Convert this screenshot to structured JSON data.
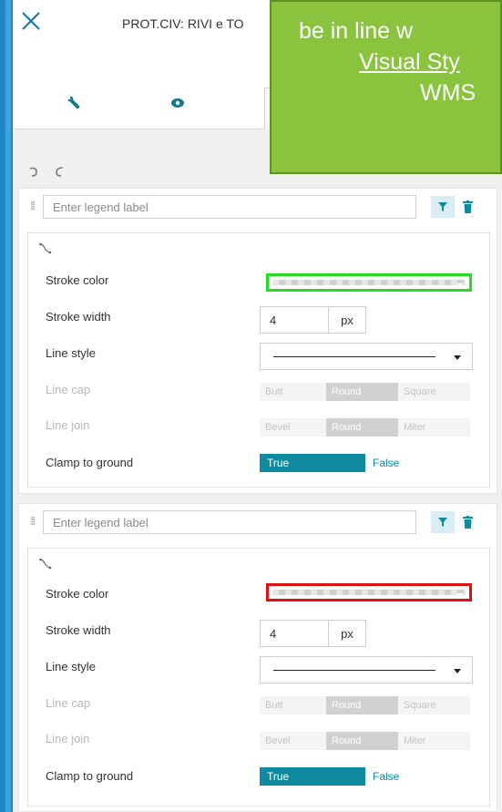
{
  "header": {
    "layer_title": "PROT.CIV: RIVI e TO",
    "tabs": [
      {
        "icon": "wrench-icon"
      },
      {
        "icon": "eye-icon"
      },
      {
        "icon": "style-icon"
      }
    ]
  },
  "callout": {
    "line1": "be in line w",
    "line2": "Visual Sty",
    "line3": "WMS",
    "color": "#8ac43f"
  },
  "toolbar": {
    "undo_icon": "undo-icon",
    "redo_icon": "redo-icon"
  },
  "rules": [
    {
      "legend_placeholder": "Enter legend label",
      "stroke_color_label": "Stroke color",
      "stroke_color": "#22dd22",
      "stroke_width_label": "Stroke width",
      "stroke_width": "4",
      "stroke_width_unit": "px",
      "line_style_label": "Line style",
      "line_cap_label": "Line cap",
      "line_cap_options": [
        "Butt",
        "Round",
        "Square"
      ],
      "line_cap_selected": "Round",
      "line_join_label": "Line join",
      "line_join_options": [
        "Bevel",
        "Round",
        "Miter"
      ],
      "line_join_selected": "Round",
      "clamp_label": "Clamp to ground",
      "clamp_true": "True",
      "clamp_false": "False",
      "clamp_selected": "True"
    },
    {
      "legend_placeholder": "Enter legend label",
      "stroke_color_label": "Stroke color",
      "stroke_color": "#dd1111",
      "stroke_width_label": "Stroke width",
      "stroke_width": "4",
      "stroke_width_unit": "px",
      "line_style_label": "Line style",
      "line_cap_label": "Line cap",
      "line_cap_options": [
        "Butt",
        "Round",
        "Square"
      ],
      "line_cap_selected": "Round",
      "line_join_label": "Line join",
      "line_join_options": [
        "Bevel",
        "Round",
        "Miter"
      ],
      "line_join_selected": "Round",
      "clamp_label": "Clamp to ground",
      "clamp_true": "True",
      "clamp_false": "False",
      "clamp_selected": "True"
    }
  ],
  "colors": {
    "accent": "#0f8a9e",
    "page_bg": "#2b8fcf"
  }
}
